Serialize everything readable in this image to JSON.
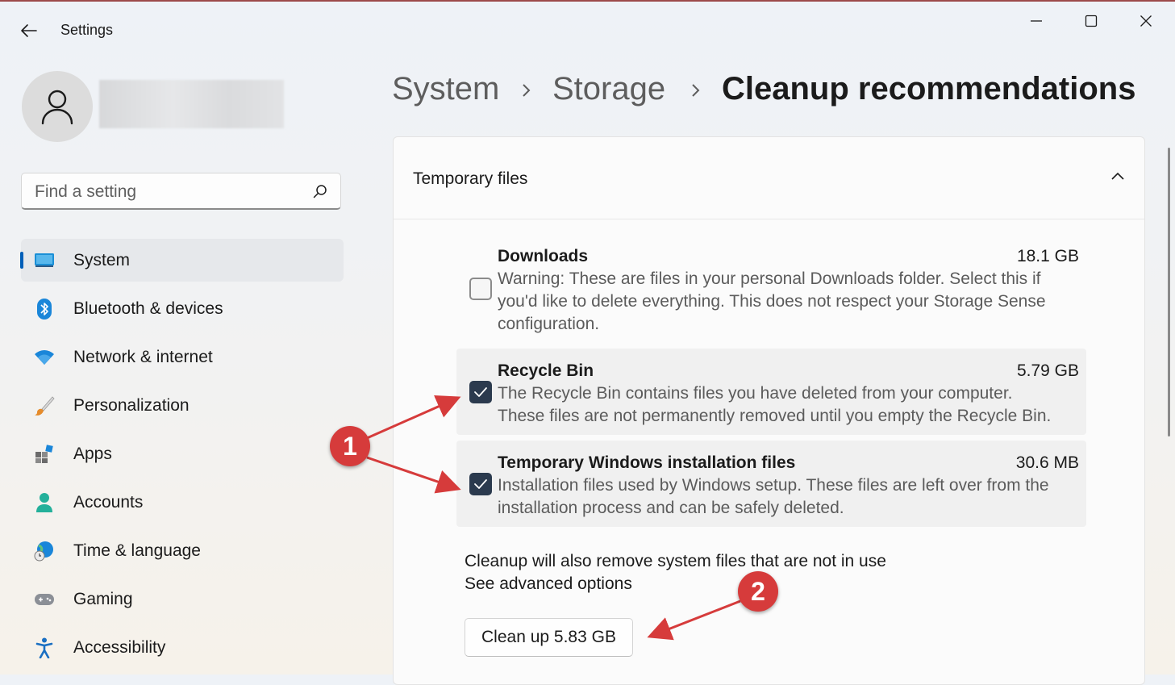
{
  "window": {
    "title": "Settings",
    "controls": {
      "minimize": "minimize-icon",
      "maximize": "maximize-icon",
      "close": "close-icon"
    }
  },
  "sidebar": {
    "search": {
      "placeholder": "Find a setting"
    },
    "items": [
      {
        "label": "System",
        "icon": "system-monitor-icon",
        "active": true
      },
      {
        "label": "Bluetooth & devices",
        "icon": "bluetooth-icon"
      },
      {
        "label": "Network & internet",
        "icon": "wifi-icon"
      },
      {
        "label": "Personalization",
        "icon": "brush-icon"
      },
      {
        "label": "Apps",
        "icon": "apps-icon"
      },
      {
        "label": "Accounts",
        "icon": "person-icon"
      },
      {
        "label": "Time & language",
        "icon": "globe-clock-icon"
      },
      {
        "label": "Gaming",
        "icon": "gamepad-icon"
      },
      {
        "label": "Accessibility",
        "icon": "accessibility-icon"
      }
    ]
  },
  "breadcrumb": {
    "items": [
      "System",
      "Storage",
      "Cleanup recommendations"
    ]
  },
  "section": {
    "title": "Temporary files",
    "rows": [
      {
        "title": "Downloads",
        "size": "18.1 GB",
        "checked": false,
        "desc": "Warning: These are files in your personal Downloads folder. Select this if you'd like to delete everything. This does not respect your Storage Sense configuration."
      },
      {
        "title": "Recycle Bin",
        "size": "5.79 GB",
        "checked": true,
        "desc": "The Recycle Bin contains files you have deleted from your computer. These files are not permanently removed until you empty the Recycle Bin."
      },
      {
        "title": "Temporary Windows installation files",
        "size": "30.6 MB",
        "checked": true,
        "desc": "Installation files used by Windows setup.  These files are left over from the installation process and can be safely deleted."
      }
    ],
    "note": "Cleanup will also remove system files that are not in use",
    "advanced_link": "See advanced options",
    "cleanup_button": "Clean up 5.83 GB"
  },
  "annotations": {
    "badge1": "1",
    "badge2": "2",
    "color": "#d63b3b"
  },
  "colors": {
    "accent": "#005fb8",
    "checkbox_checked": "#2b3a4e",
    "annotation": "#d63b3b"
  }
}
